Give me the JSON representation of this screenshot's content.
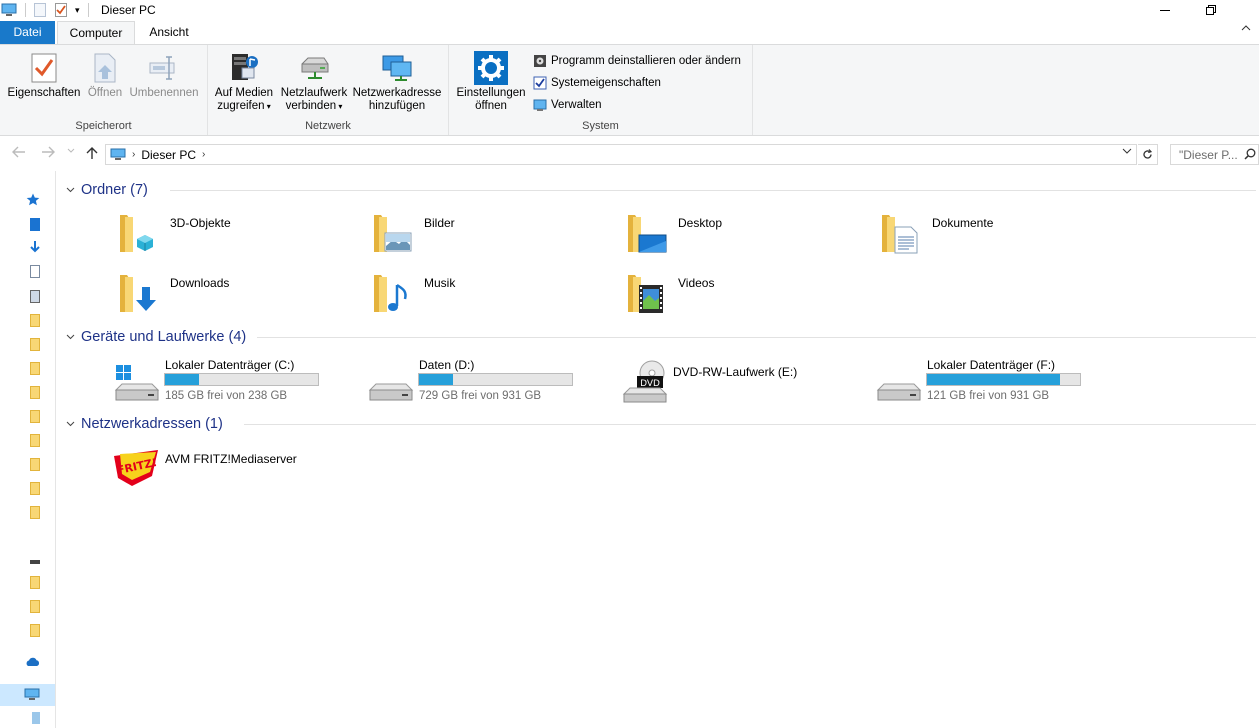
{
  "window": {
    "title": "Dieser PC",
    "minimize_icon": "minimize-icon",
    "maximize_icon": "restore-icon"
  },
  "ribbon_tabs": [
    {
      "label": "Datei"
    },
    {
      "label": "Computer"
    },
    {
      "label": "Ansicht"
    }
  ],
  "ribbon": {
    "groups": {
      "location": {
        "label": "Speicherort",
        "buttons": [
          {
            "label": "Eigenschaften",
            "enabled": true
          },
          {
            "label": "Öffnen",
            "enabled": false
          },
          {
            "label": "Umbenennen",
            "enabled": false
          }
        ]
      },
      "network": {
        "label": "Netzwerk",
        "buttons": [
          {
            "line1": "Auf Medien",
            "line2": "zugreifen",
            "dropdown": true
          },
          {
            "line1": "Netzlaufwerk",
            "line2": "verbinden",
            "dropdown": true
          },
          {
            "line1": "Netzwerkadresse",
            "line2": "hinzufügen",
            "dropdown": false
          }
        ]
      },
      "system": {
        "label": "System",
        "big_button": {
          "line1": "Einstellungen",
          "line2": "öffnen"
        },
        "small_buttons": [
          {
            "label": "Programm deinstallieren oder ändern"
          },
          {
            "label": "Systemeigenschaften"
          },
          {
            "label": "Verwalten"
          }
        ]
      }
    }
  },
  "address_bar": {
    "path": "Dieser PC",
    "search_placeholder": "\"Dieser P..."
  },
  "colors": {
    "accent": "#1979ca",
    "section_header": "#1e3287",
    "drive_bar_fill": "#26a0da",
    "folder_yellow": "#f8d775"
  },
  "sections": {
    "folders": {
      "header": "Ordner (7)",
      "items": [
        {
          "label": "3D-Objekte",
          "icon": "folder-3d-objects-icon"
        },
        {
          "label": "Bilder",
          "icon": "folder-pictures-icon"
        },
        {
          "label": "Desktop",
          "icon": "folder-desktop-icon"
        },
        {
          "label": "Dokumente",
          "icon": "folder-documents-icon"
        },
        {
          "label": "Downloads",
          "icon": "folder-downloads-icon"
        },
        {
          "label": "Musik",
          "icon": "folder-music-icon"
        },
        {
          "label": "Videos",
          "icon": "folder-videos-icon"
        }
      ]
    },
    "drives": {
      "header": "Geräte und Laufwerke (4)",
      "items": [
        {
          "label": "Lokaler Datenträger (C:)",
          "free": "185 GB frei von 238 GB",
          "used_fraction": 0.22,
          "icon": "windows-drive-icon"
        },
        {
          "label": "Daten (D:)",
          "free": "729 GB frei von 931 GB",
          "used_fraction": 0.22,
          "icon": "hard-drive-icon"
        },
        {
          "label": "DVD-RW-Laufwerk (E:)",
          "icon": "dvd-drive-icon"
        },
        {
          "label": "Lokaler Datenträger (F:)",
          "free": "121 GB frei von 931 GB",
          "used_fraction": 0.87,
          "icon": "hard-drive-icon"
        }
      ]
    },
    "network": {
      "header": "Netzwerkadressen (1)",
      "items": [
        {
          "label": "AVM FRITZ!Mediaserver",
          "icon": "fritz-logo-icon",
          "logo_text": "FRITZ!"
        }
      ]
    }
  }
}
